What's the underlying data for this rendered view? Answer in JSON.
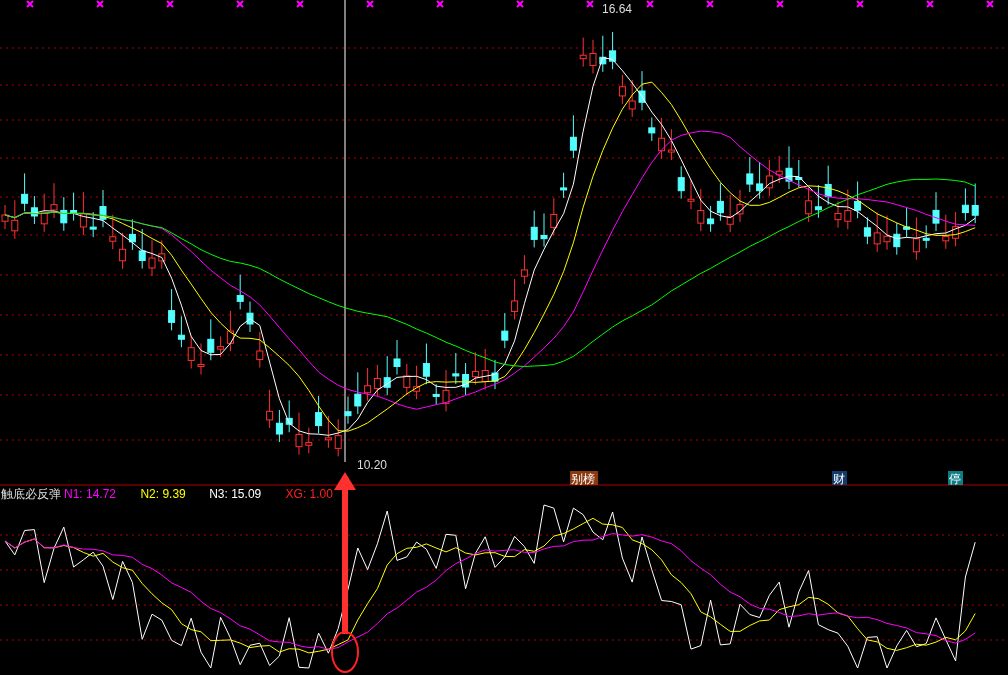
{
  "main_chart": {
    "high_label": "16.64",
    "low_label": "10.20"
  },
  "event_badges": [
    {
      "text": "别榜",
      "color": "#8b3a10"
    },
    {
      "text": "财",
      "color": "#123a6b"
    },
    {
      "text": "停",
      "color": "#0e7e86"
    }
  ],
  "indicator": {
    "name": "触底必反弹",
    "params": [
      {
        "label": "N1: 14.72",
        "color": "#ff00ff"
      },
      {
        "label": "N2: 9.39",
        "color": "#ffff00"
      },
      {
        "label": "N3: 15.09",
        "color": "#ffffff"
      },
      {
        "label": "XG: 1.00",
        "color": "#ff2020"
      }
    ]
  }
}
